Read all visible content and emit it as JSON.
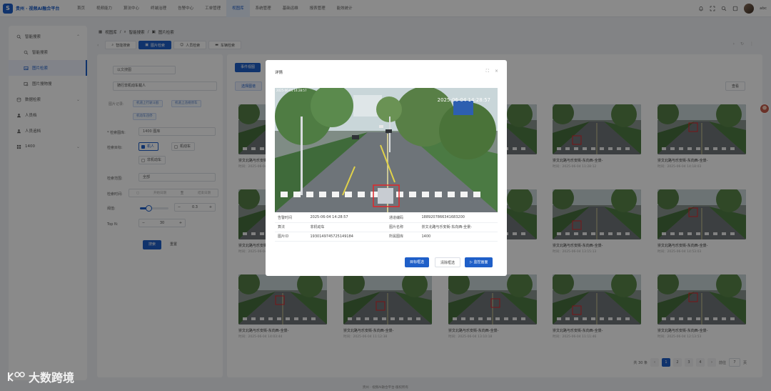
{
  "app": {
    "title": "贵州 · 视频AI融合平台"
  },
  "nav": [
    "首页",
    "视频能力",
    "算法中心",
    "终端治理",
    "告警中心",
    "工单管理",
    "视图库",
    "系统管理",
    "基础运维",
    "报表管理",
    "能效统计"
  ],
  "user": {
    "name": "abc"
  },
  "sidebar": [
    {
      "label": "智能搜索",
      "icon": "search-icon",
      "level": 0,
      "expanded": true
    },
    {
      "label": "智能搜索",
      "icon": "search-icon",
      "level": 1
    },
    {
      "label": "图片检索",
      "icon": "image-icon",
      "level": 1,
      "active": true
    },
    {
      "label": "图片搜物搜",
      "icon": "image-search-icon",
      "level": 1
    },
    {
      "label": "数据检索",
      "icon": "database-icon",
      "level": 0,
      "collapsed": true
    },
    {
      "label": "人员档",
      "icon": "person-icon",
      "level": 0
    },
    {
      "label": "人员追档",
      "icon": "person-icon",
      "level": 0
    },
    {
      "label": "1400",
      "icon": "grid-icon",
      "level": 0,
      "collapsed": true
    }
  ],
  "breadcrumb": [
    "视图库",
    "智能搜索",
    "图片检索"
  ],
  "tabs": [
    "智能搜索",
    "图片检索",
    "人员检索",
    "车辆检索"
  ],
  "filter": {
    "mode": "以文搜图",
    "query": "骑行非机动车载人",
    "quick_label": "图片记录:",
    "quick_tags": [
      "机道上行驶斗殴",
      "机道上违规停车",
      "机动车违停"
    ],
    "type_label": "* 检索图库:",
    "type_value": "1400 图库",
    "object_label": "检索目标:",
    "objects": [
      {
        "label": "机人",
        "checked": true
      },
      {
        "label": "机动车",
        "checked": false
      },
      {
        "label": "非机动车",
        "checked": false
      }
    ],
    "range_label": "检索范围:",
    "range_value": "全部",
    "time_label": "检索时间:",
    "time_start": "开始日期",
    "time_sep": "至",
    "time_end": "结束日期",
    "threshold_label": "阈值:",
    "threshold_value": "0.3",
    "threshold_level": 0.3,
    "topn_label": "Top N:",
    "topn_value": "30",
    "search_btn": "搜索",
    "reset_btn": "重置"
  },
  "content": {
    "view_btn": "事件视图",
    "select_btn": "选择图谱",
    "more_btn": "查看",
    "cards": [
      {
        "title": "崇文北路与乐安街-东向西-全景-",
        "time": "时间：2025-06-04 11:28:57"
      },
      {
        "title": "崇文北路与乐安街-东向西-全景-",
        "time": "时间：2025-06-04 11:28:57"
      },
      {
        "title": "崇文北路与乐安街-东向西-全景-",
        "time": "时间：2025-06-04 11:28:57"
      },
      {
        "title": "崇文北路与乐安街-东向西-全景-",
        "time": "时间：2025-06-04 11:28:12"
      },
      {
        "title": "崇文北路与乐安街-东向西-全景-",
        "time": "时间：2025-06-04 14:18:03"
      },
      {
        "title": "崇文北路与乐安街-东向西-全景-",
        "time": "时间：2025-06-04 14:17:33"
      },
      {
        "title": "崇文北路与乐安街-东向西-全景-",
        "time": "时间：2025-06-04 13:56:57"
      },
      {
        "title": "崇文北路与乐安街-东向西-全景-",
        "time": "时间：2025-06-04 13:35:44"
      },
      {
        "title": "崇文北路与乐安街-东向西-全景-",
        "time": "时间：2025-06-04 13:15:13"
      },
      {
        "title": "崇文北路与乐安街-东向西-全景-",
        "time": "时间：2025-06-04 14:53:03"
      },
      {
        "title": "崇文北路与乐安街-东向西-全景-",
        "time": "时间：2025-06-04 14:03:44"
      },
      {
        "title": "崇文北路与乐安街-东向西-全景-",
        "time": "时间：2025-06-04 11:12:38"
      },
      {
        "title": "崇文北路与乐安街-东向西-全景-",
        "time": "时间：2025-06-04 13:10:18"
      },
      {
        "title": "崇文北路与乐安街-东向西-全景-",
        "time": "时间：2025-06-04 11:11:46"
      },
      {
        "title": "崇文北路与乐安街-东向西-全景-",
        "time": "时间：2025-06-04 12:13:53"
      }
    ],
    "pagination": {
      "total": "共 30 条",
      "pages": [
        "1",
        "2",
        "3",
        "4"
      ],
      "current": "1",
      "goto_label": "前往",
      "goto_value": "7",
      "page_unit": "页"
    }
  },
  "modal": {
    "title": "详情",
    "overlay_time": "2025-06-04 14:28:57",
    "fields": [
      {
        "k": "告警时间",
        "v": "2025-06-04 14:28:57",
        "k2": "通道编码",
        "v2": "1889207866341683200"
      },
      {
        "k": "算法",
        "v": "非机动车",
        "k2": "图片名称",
        "v2": "崇文北路与乐安街-东向西-全景-"
      },
      {
        "k": "图片ID",
        "v": "1930149745725149184",
        "k2": "所属图库",
        "v2": "1400"
      }
    ],
    "btn_target": "目标框选",
    "btn_clear": "清除框选",
    "btn_monitor": "监控画面"
  },
  "watermark": "大数跨境",
  "footer": "贵州 · 视频AI融合平台·版权所有",
  "colors": {
    "primary": "#1f5fc8",
    "alert_box": "#e0262b"
  }
}
